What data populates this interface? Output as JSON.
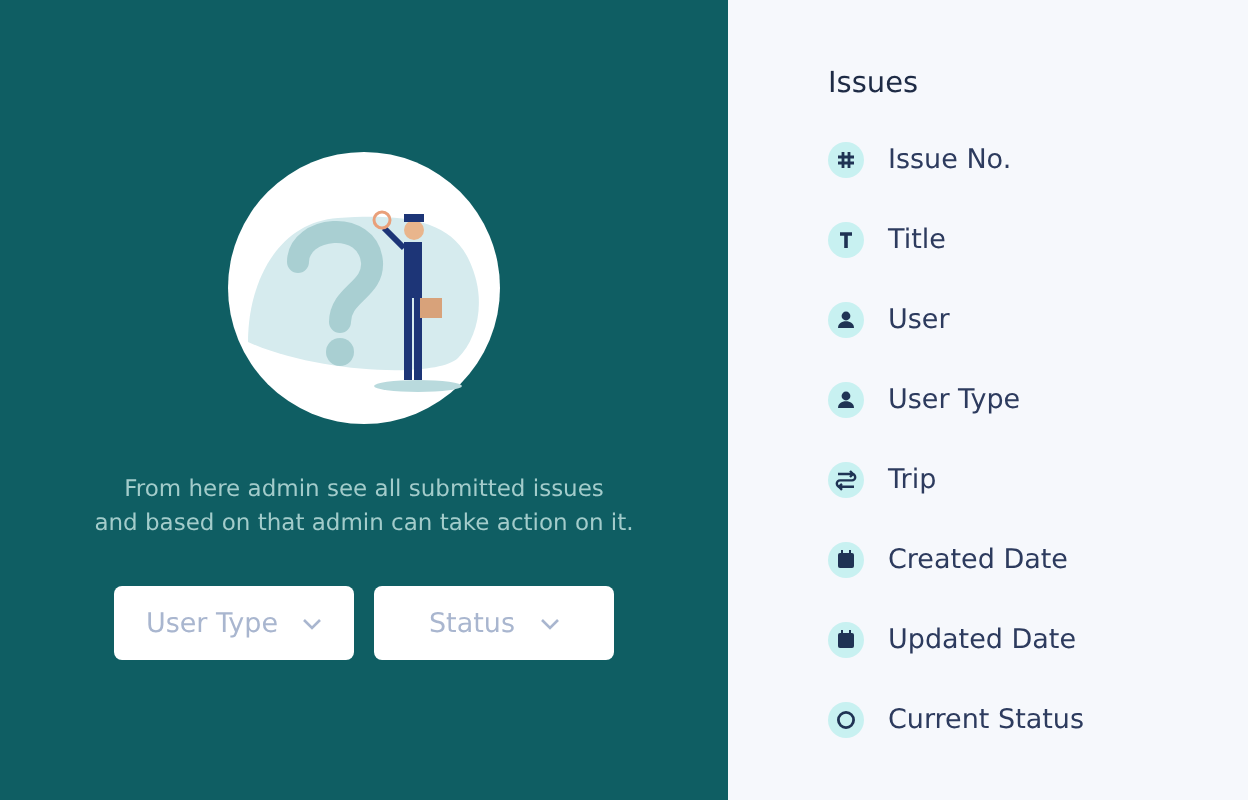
{
  "intro": {
    "description": "From here admin see all submitted issues\nand based on that admin can take action on it.",
    "filters": [
      {
        "label": "User Type"
      },
      {
        "label": "Status"
      }
    ]
  },
  "issues": {
    "title": "Issues",
    "fields": [
      {
        "kind": "hash",
        "label": "Issue No."
      },
      {
        "kind": "text",
        "label": "Title"
      },
      {
        "kind": "user",
        "label": "User"
      },
      {
        "kind": "user",
        "label": "User Type"
      },
      {
        "kind": "route",
        "label": "Trip"
      },
      {
        "kind": "calendar",
        "label": "Created Date"
      },
      {
        "kind": "calendar",
        "label": "Updated Date"
      },
      {
        "kind": "status",
        "label": "Current Status"
      }
    ]
  }
}
